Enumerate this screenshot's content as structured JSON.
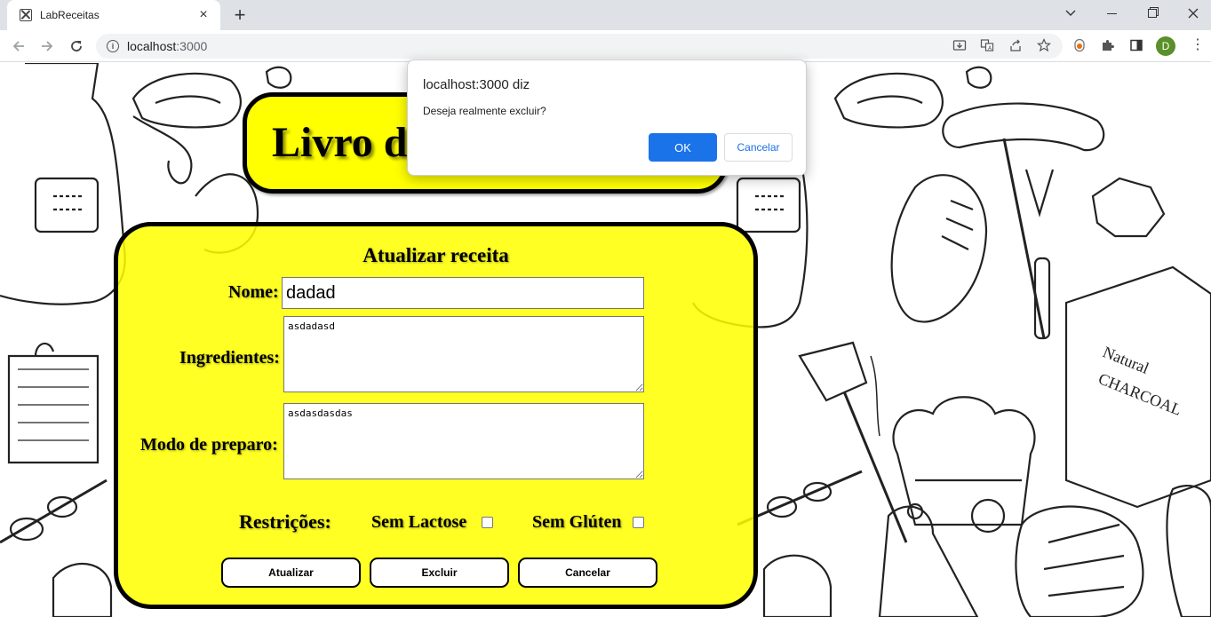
{
  "browser": {
    "tab_title": "LabReceitas",
    "tab_close": "×",
    "new_tab": "+",
    "url_host": "localhost",
    "url_port": ":3000",
    "avatar_letter": "D"
  },
  "page": {
    "app_title": "Livro de Receitas",
    "form": {
      "title": "Atualizar receita",
      "nome_label": "Nome:",
      "nome_value": "dadad",
      "ingredientes_label": "Ingredientes:",
      "ingredientes_value": "asdadasd",
      "modo_label": "Modo de preparo:",
      "modo_value": "asdasdasdas",
      "restricoes_label": "Restrições:",
      "sem_lactose_label": "Sem Lactose",
      "sem_lactose_checked": false,
      "sem_gluten_label": "Sem Glúten",
      "sem_gluten_checked": false,
      "btn_atualizar": "Atualizar",
      "btn_excluir": "Excluir",
      "btn_cancelar": "Cancelar"
    }
  },
  "dialog": {
    "title": "localhost:3000 diz",
    "message": "Deseja realmente excluir?",
    "ok_label": "OK",
    "cancel_label": "Cancelar"
  },
  "colors": {
    "accent_yellow": "#ffff00",
    "dialog_ok_blue": "#1a73e8"
  }
}
